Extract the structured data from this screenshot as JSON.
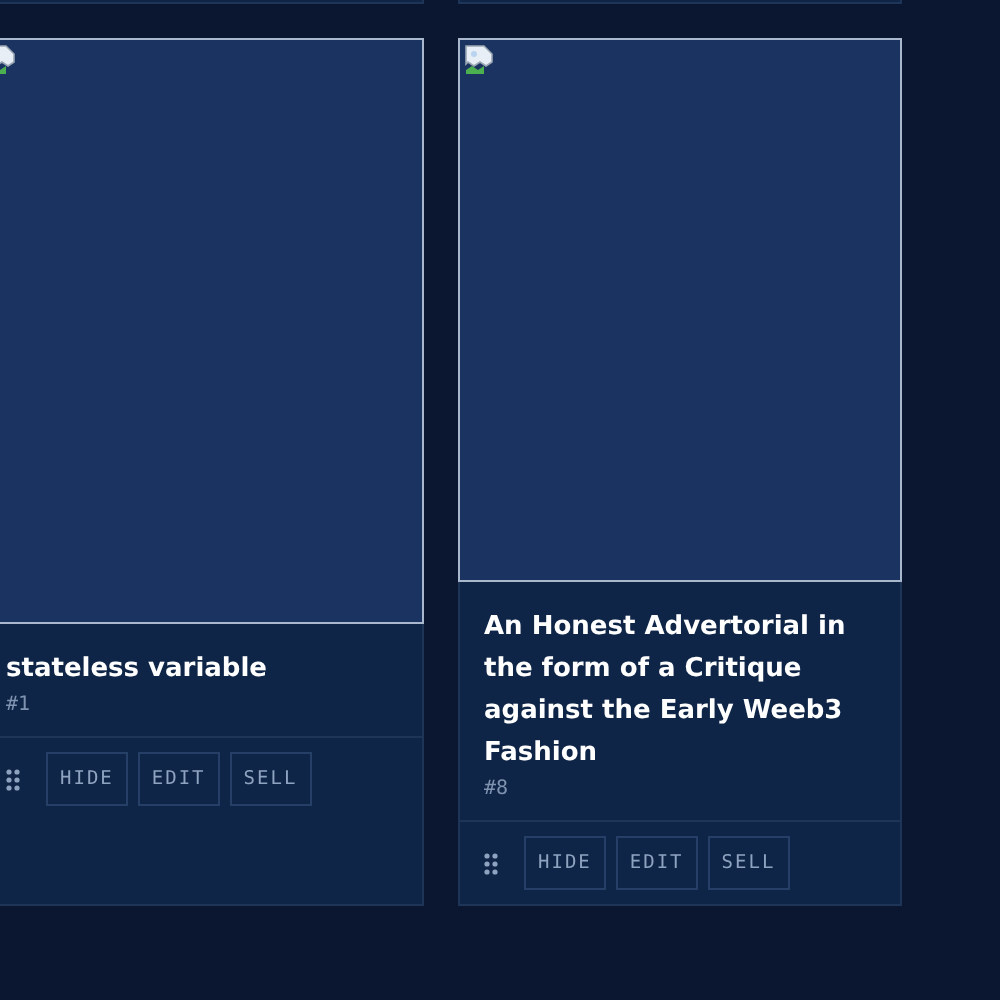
{
  "cards": [
    {
      "title": "stateless variable",
      "number": "#1",
      "buttons": [
        "HIDE",
        "EDIT",
        "SELL"
      ]
    },
    {
      "title": "An Honest Advertorial in the form of a Critique against the Early Weeb3 Fashion",
      "number": "#8",
      "buttons": [
        "HIDE",
        "EDIT",
        "SELL"
      ]
    }
  ]
}
